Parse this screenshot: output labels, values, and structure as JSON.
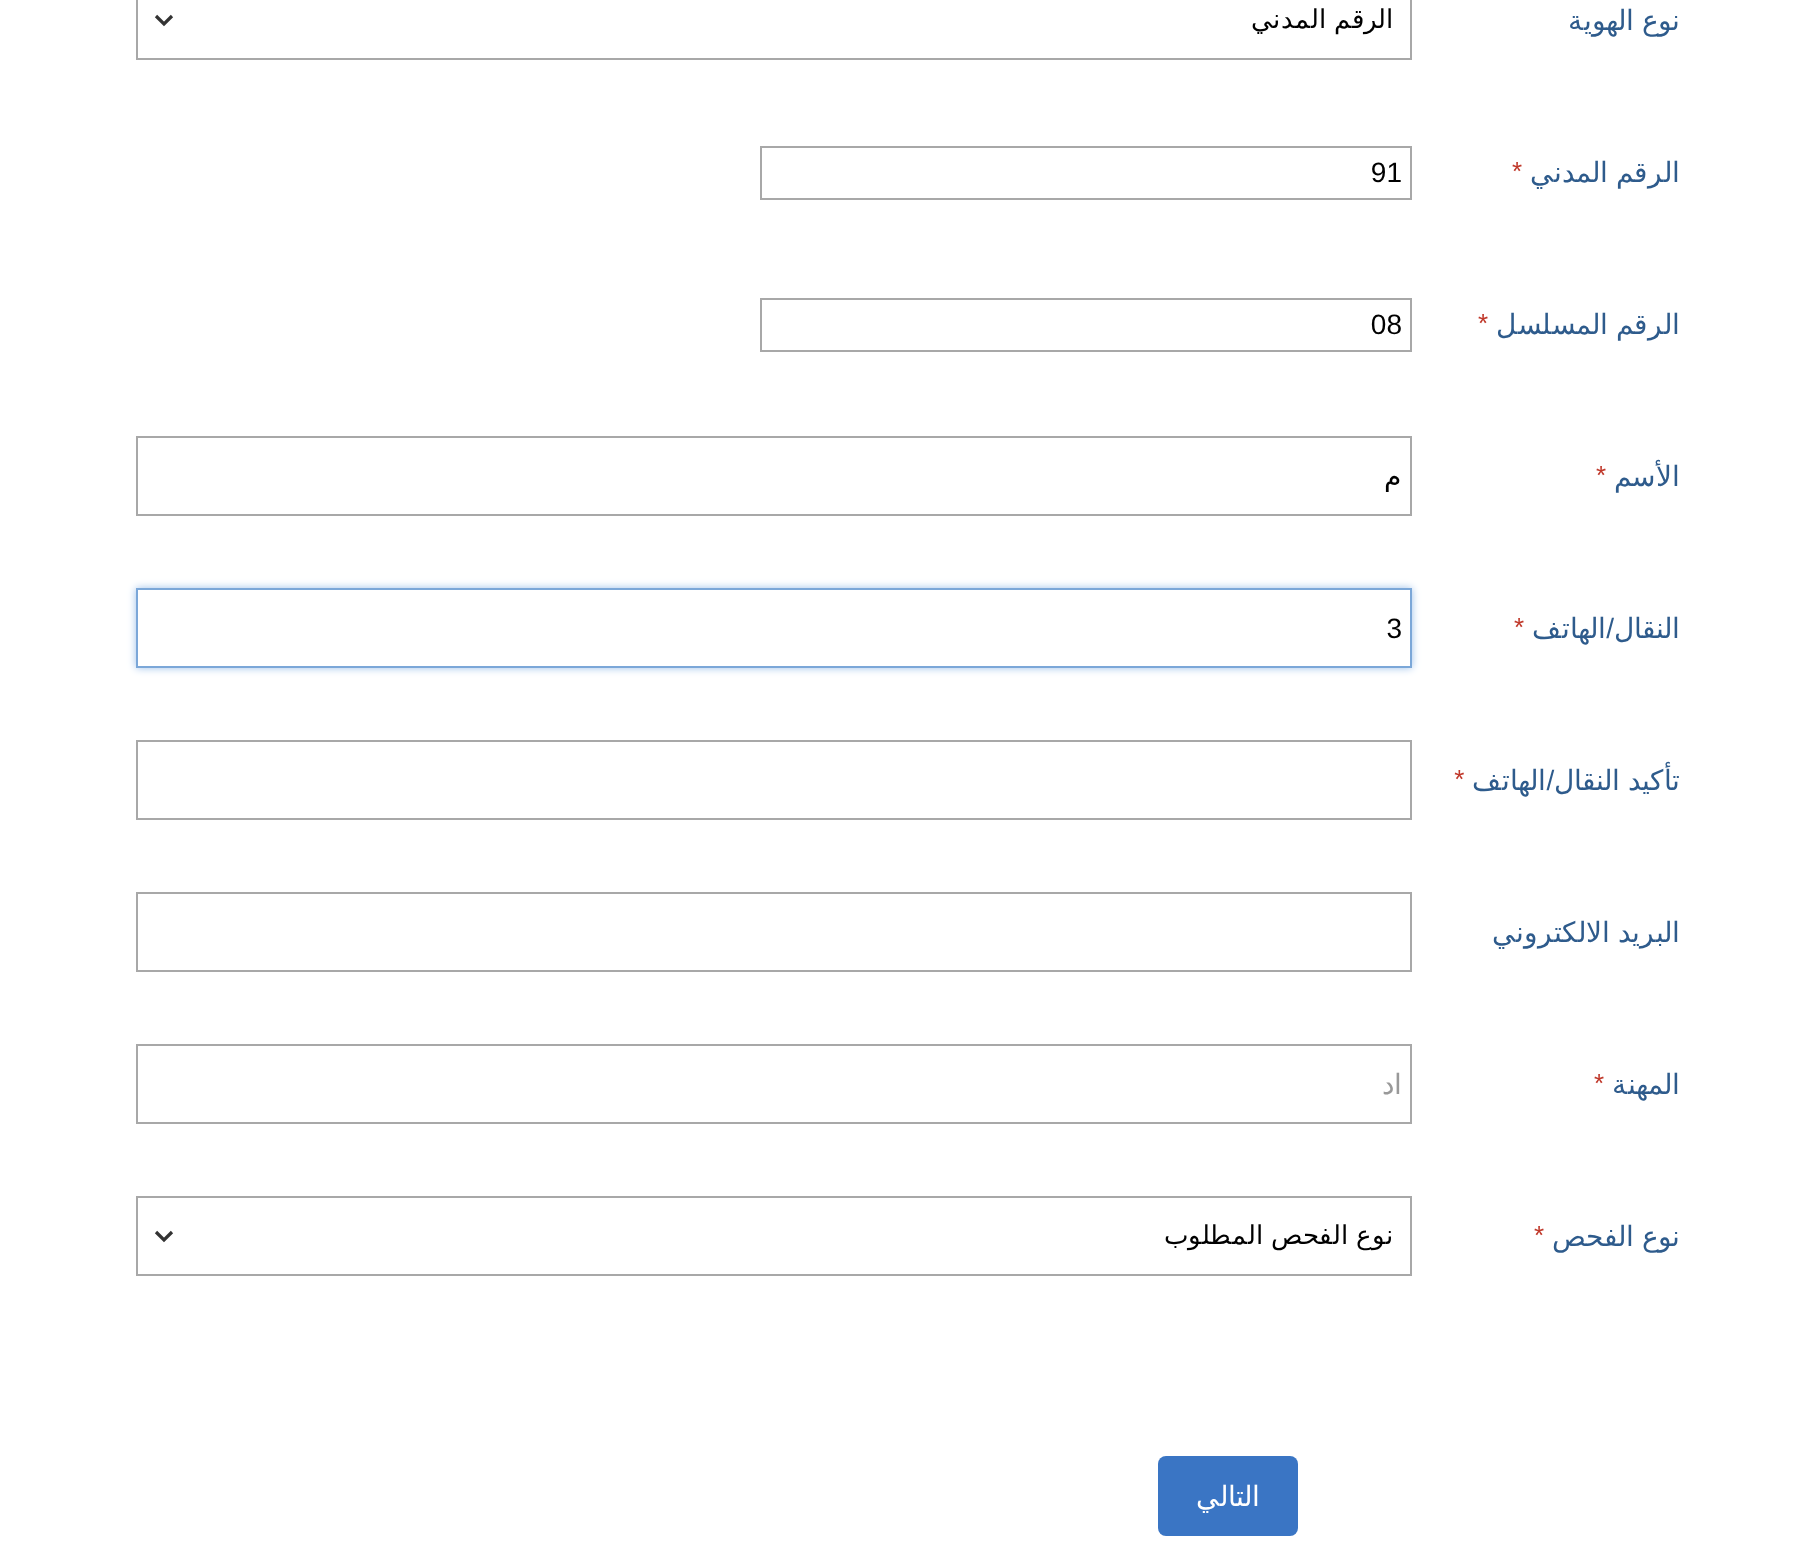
{
  "fields": [
    {
      "kind": "select",
      "label": "نوع الهوية",
      "value": "الرقم المدني",
      "focused": false
    },
    {
      "kind": "short",
      "label": "الرقم المدني",
      "mark": "*",
      "value": "91",
      "focused": false
    },
    {
      "kind": "short",
      "label": "الرقم المسلسل",
      "mark": "*",
      "value": "08",
      "focused": false
    },
    {
      "kind": "text",
      "label": "الأسم",
      "mark": "*",
      "value": "م",
      "focused": false
    },
    {
      "kind": "text",
      "label": "النقال/الهاتف",
      "mark": "*",
      "value": "3",
      "focused": true
    },
    {
      "kind": "text",
      "label": "تأكيد النقال/الهاتف",
      "mark": "*",
      "focused": false
    },
    {
      "kind": "text",
      "label": "البريد الالكتروني",
      "focused": false
    },
    {
      "kind": "text",
      "label": "المهنة",
      "mark": "*",
      "placeholder": "اد",
      "focused": false
    },
    {
      "kind": "select",
      "label": "نوع الفحص",
      "mark": "*",
      "value": "نوع الفحص المطلوب",
      "focused": false
    }
  ],
  "next_button": "التالي"
}
